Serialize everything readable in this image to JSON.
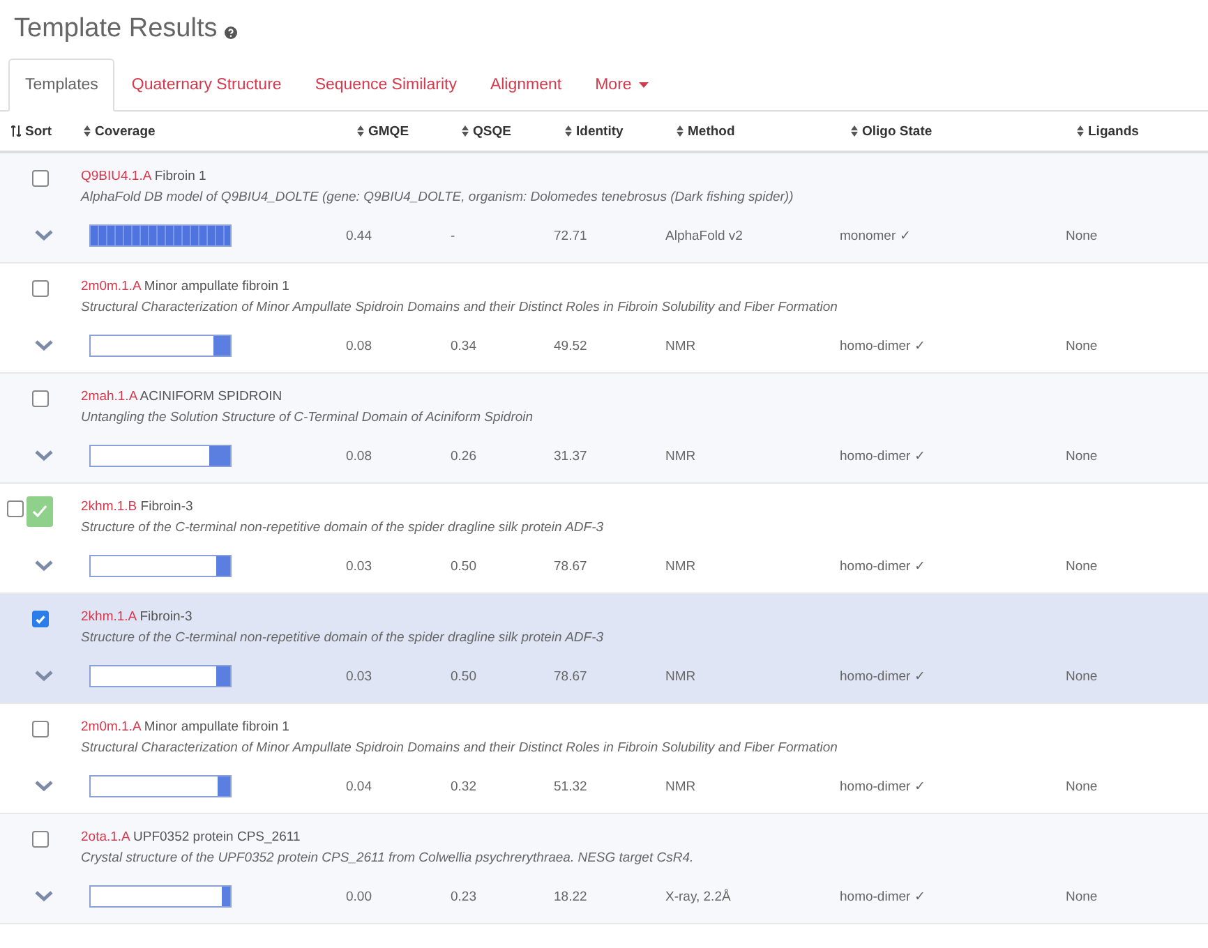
{
  "title": "Template Results",
  "tabs": [
    {
      "label": "Templates",
      "selected": true
    },
    {
      "label": "Quaternary Structure",
      "selected": false
    },
    {
      "label": "Sequence Similarity",
      "selected": false
    },
    {
      "label": "Alignment",
      "selected": false
    },
    {
      "label": "More",
      "selected": false,
      "kind": "dropdown"
    }
  ],
  "columns": [
    "Sort",
    "Coverage",
    "GMQE",
    "QSQE",
    "Identity",
    "Method",
    "Oligo State",
    "Ligands"
  ],
  "rows": [
    {
      "selected": false,
      "flagged": false,
      "id": "Q9BIU4.1.A",
      "name": "Fibroin 1",
      "description": "AlphaFold DB model of Q9BIU4_DOLTE (gene: Q9BIU4_DOLTE, organism: Dolomedes tenebrosus (Dark fishing spider))",
      "level": 1.0,
      "gmqe": "0.44",
      "qsqe": "-",
      "identity": "72.71",
      "method": "AlphaFold v2",
      "oligo_state": "monomer ✓",
      "ligands": "None"
    },
    {
      "selected": false,
      "flagged": false,
      "id": "2m0m.1.A",
      "name": "Minor ampullate fibroin 1",
      "description": "Structural Characterization of Minor Ampullate Spidroin Domains and their Distinct Roles in Fibroin Solubility and Fiber Formation",
      "level": 0.12,
      "gmqe": "0.08",
      "qsqe": "0.34",
      "identity": "49.52",
      "method": "NMR",
      "oligo_state": "homo-dimer ✓",
      "ligands": "None"
    },
    {
      "selected": false,
      "flagged": false,
      "id": "2mah.1.A",
      "name": "ACINIFORM SPIDROIN",
      "description": "Untangling the Solution Structure of C-Terminal Domain of Aciniform Spidroin",
      "level": 0.15,
      "gmqe": "0.08",
      "qsqe": "0.26",
      "identity": "31.37",
      "method": "NMR",
      "oligo_state": "homo-dimer ✓",
      "ligands": "None"
    },
    {
      "selected": false,
      "flagged": true,
      "id": "2khm.1.B",
      "name": "Fibroin-3",
      "description": "Structure of the C-terminal non-repetitive domain of the spider dragline silk protein ADF-3",
      "level": 0.1,
      "gmqe": "0.03",
      "qsqe": "0.50",
      "identity": "78.67",
      "method": "NMR",
      "oligo_state": "homo-dimer ✓",
      "ligands": "None"
    },
    {
      "selected": true,
      "flagged": false,
      "id": "2khm.1.A",
      "name": "Fibroin-3",
      "description": "Structure of the C-terminal non-repetitive domain of the spider dragline silk protein ADF-3",
      "level": 0.1,
      "gmqe": "0.03",
      "qsqe": "0.50",
      "identity": "78.67",
      "method": "NMR",
      "oligo_state": "homo-dimer ✓",
      "ligands": "None"
    },
    {
      "selected": false,
      "flagged": false,
      "id": "2m0m.1.A",
      "name": "Minor ampullate fibroin 1",
      "description": "Structural Characterization of Minor Ampullate Spidroin Domains and their Distinct Roles in Fibroin Solubility and Fiber Formation",
      "level": 0.09,
      "gmqe": "0.04",
      "qsqe": "0.32",
      "identity": "51.32",
      "method": "NMR",
      "oligo_state": "homo-dimer ✓",
      "ligands": "None"
    },
    {
      "selected": false,
      "flagged": false,
      "id": "2ota.1.A",
      "name": "UPF0352 protein CPS_2611",
      "description": "Crystal structure of the UPF0352 protein CPS_2611 from Colwellia psychrerythraea. NESG target CsR4.",
      "level": 0.06,
      "gmqe": "0.00",
      "qsqe": "0.23",
      "identity": "18.22",
      "method": "X-ray, 2.2Å",
      "oligo_state": "homo-dimer ✓",
      "ligands": "None"
    }
  ]
}
